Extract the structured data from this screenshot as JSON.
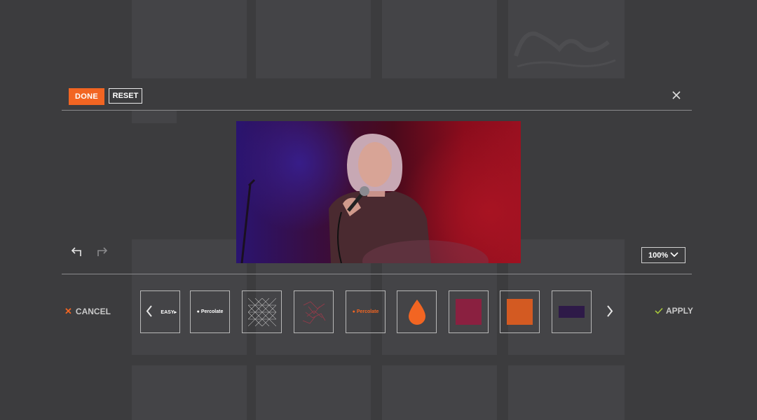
{
  "toolbar": {
    "done_label": "DONE",
    "reset_label": "RESET"
  },
  "zoom": {
    "value": "100%"
  },
  "footer": {
    "cancel_label": "CANCEL",
    "apply_label": "APPLY"
  },
  "filters": [
    {
      "name": "easy-logo-filter",
      "label": "EASY▸"
    },
    {
      "name": "percolate-white-filter",
      "label": "● Percolate"
    },
    {
      "name": "triangle-grid-filter",
      "label": ""
    },
    {
      "name": "red-pattern-filter",
      "label": ""
    },
    {
      "name": "percolate-orange-filter",
      "label": "● Percolate"
    },
    {
      "name": "orange-drop-filter",
      "label": ""
    },
    {
      "name": "crimson-square-filter",
      "label": ""
    },
    {
      "name": "orange-square-filter",
      "label": ""
    },
    {
      "name": "purple-rect-filter",
      "label": ""
    }
  ],
  "colors": {
    "accent": "#f26522",
    "apply_check": "#a6c63a",
    "crimson": "#8a2040",
    "orange": "#d35a22",
    "purple": "#2e1a48"
  }
}
